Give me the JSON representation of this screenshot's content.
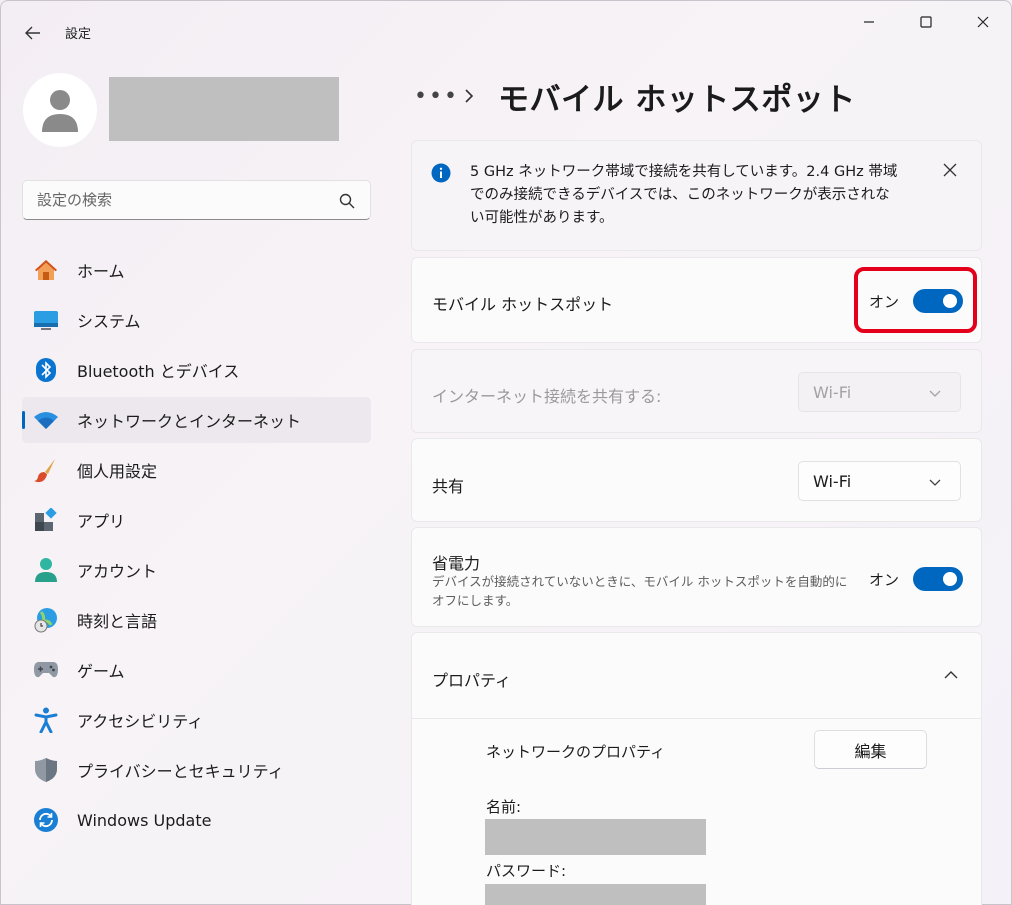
{
  "window": {
    "app_title": "設定"
  },
  "search": {
    "placeholder": "設定の検索"
  },
  "sidebar": {
    "items": [
      {
        "label": "ホーム",
        "icon": "home-icon"
      },
      {
        "label": "システム",
        "icon": "system-icon"
      },
      {
        "label": "Bluetooth とデバイス",
        "icon": "bluetooth-icon"
      },
      {
        "label": "ネットワークとインターネット",
        "icon": "wifi-icon",
        "active": true
      },
      {
        "label": "個人用設定",
        "icon": "paintbrush-icon"
      },
      {
        "label": "アプリ",
        "icon": "apps-icon"
      },
      {
        "label": "アカウント",
        "icon": "account-icon"
      },
      {
        "label": "時刻と言語",
        "icon": "globe-clock-icon"
      },
      {
        "label": "ゲーム",
        "icon": "gamepad-icon"
      },
      {
        "label": "アクセシビリティ",
        "icon": "accessibility-icon"
      },
      {
        "label": "プライバシーとセキュリティ",
        "icon": "shield-icon"
      },
      {
        "label": "Windows Update",
        "icon": "update-icon"
      }
    ]
  },
  "breadcrumb": {
    "more": "•••",
    "title": "モバイル ホットスポット"
  },
  "info": {
    "text": "5 GHz ネットワーク帯域で接続を共有しています。2.4 GHz 帯域でのみ接続できるデバイスでは、このネットワークが表示されない可能性があります。"
  },
  "hotspot": {
    "label": "モバイル ホットスポット",
    "state": "オン"
  },
  "share_connection": {
    "label": "インターネット接続を共有する:",
    "value": "Wi-Fi"
  },
  "share": {
    "label": "共有",
    "value": "Wi-Fi"
  },
  "power_saving": {
    "label": "省電力",
    "description": "デバイスが接続されていないときに、モバイル ホットスポットを自動的にオフにします。",
    "state": "オン"
  },
  "properties": {
    "header": "プロパティ",
    "network_properties": "ネットワークのプロパティ",
    "edit_label": "編集",
    "name_label": "名前:",
    "password_label": "パスワード:"
  },
  "colors": {
    "accent": "#0067c0",
    "highlight": "#e4001b"
  }
}
